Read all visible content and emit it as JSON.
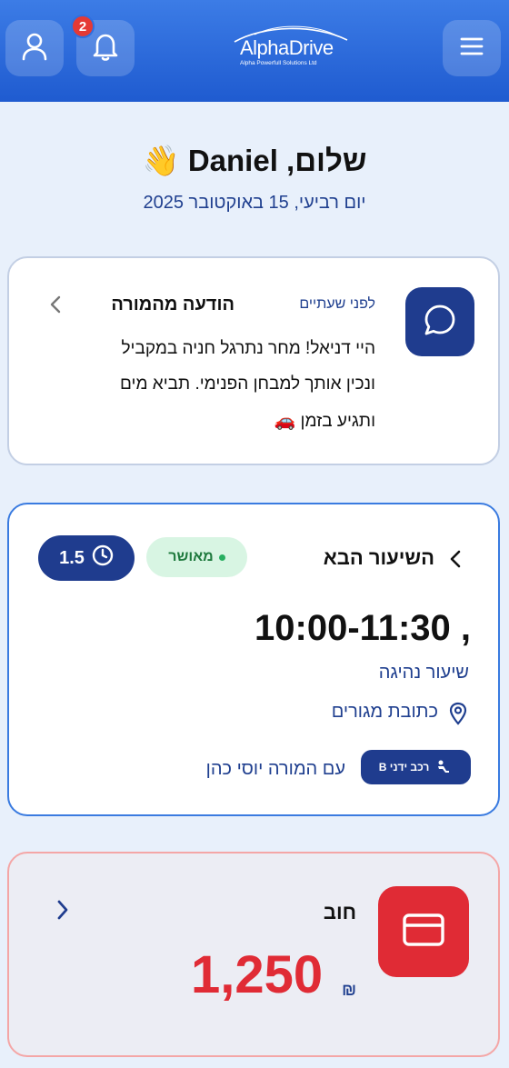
{
  "header": {
    "logo_text": "AlphaDrive",
    "logo_subtitle": "Alpha Powerfull Solutions Ltd",
    "notification_count": "2"
  },
  "greeting": "שלום, Daniel 👋",
  "date": "יום רביעי, 15 באוקטובר 2025",
  "message_card": {
    "title": "הודעה מהמורה",
    "time": "לפני שעתיים",
    "line1": "היי דניאל! מחר נתרגל חניה במקביל",
    "line2": "ונכין אותך למבחן הפנימי. תביא מים",
    "line3": "ותגיע בזמן 🚗"
  },
  "next_lesson": {
    "title": "השיעור הבא",
    "status": "מאושר",
    "duration": "1.5",
    "time": "10:00-11:30 ,",
    "type": "שיעור נהיגה",
    "location": "כתובת מגורים",
    "vehicle": "רכב ידני B",
    "teacher": "עם המורה יוסי כהן"
  },
  "debt": {
    "title": "חוב",
    "amount": "1,250",
    "currency": "₪"
  },
  "colors": {
    "primary": "#1f3c8e",
    "header": "#2f6fe0",
    "danger": "#e02b35",
    "success": "#27ae60"
  },
  "icons": {
    "profile": "user-icon",
    "notifications": "bell-icon",
    "menu": "hamburger-menu-icon",
    "message": "chat-bubble-icon",
    "clock": "clock-icon",
    "location": "map-pin-icon",
    "vehicle": "steering-car-icon",
    "payment": "credit-card-icon"
  }
}
